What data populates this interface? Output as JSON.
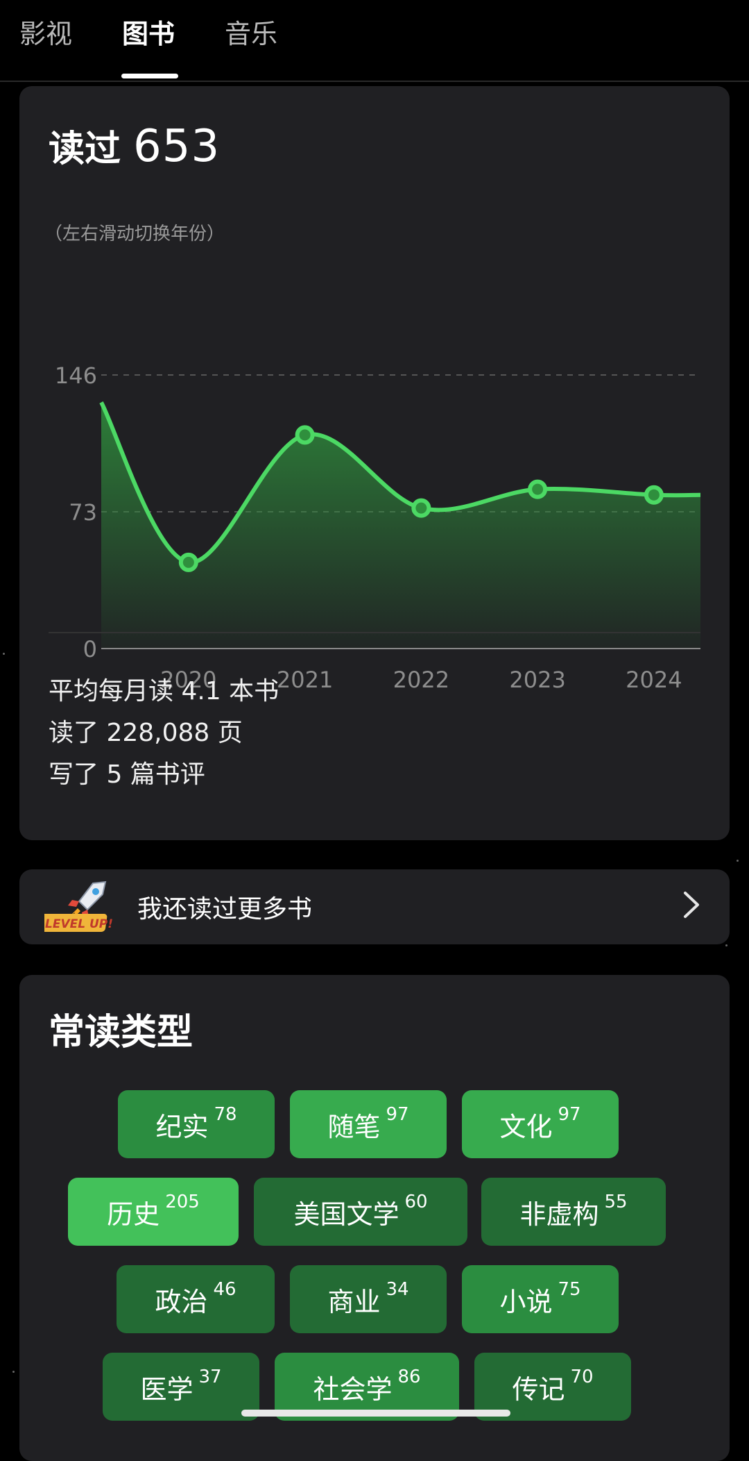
{
  "tabs": [
    {
      "label": "影视"
    },
    {
      "label": "图书"
    },
    {
      "label": "音乐"
    }
  ],
  "active_tab_index": 1,
  "stats": {
    "read_prefix": "读过",
    "read_total": "653",
    "hint": "（左右滑动切换年份）",
    "lines": [
      "平均每月读 4.1 本书",
      "读了 228,088 页",
      "写了 5 篇书评"
    ]
  },
  "chart_data": {
    "type": "area",
    "x": [
      "2020",
      "2021",
      "2022",
      "2023",
      "2024"
    ],
    "series": [
      {
        "values": [
          46,
          114,
          75,
          85,
          82
        ]
      }
    ],
    "yticks": [
      "0",
      "73",
      "146"
    ],
    "ylim": [
      0,
      146
    ],
    "grid": true,
    "line_color": "#4cd964",
    "fill_color": "#2f8f3d"
  },
  "more_books": {
    "label": "我还读过更多书",
    "icon": "rocket-level-up-icon",
    "badge_text": "LEVEL UP!"
  },
  "genres": {
    "title": "常读类型",
    "items": [
      {
        "name": "纪实",
        "count": "78"
      },
      {
        "name": "随笔",
        "count": "97"
      },
      {
        "name": "文化",
        "count": "97"
      },
      {
        "name": "历史",
        "count": "205"
      },
      {
        "name": "美国文学",
        "count": "60"
      },
      {
        "name": "非虚构",
        "count": "55"
      },
      {
        "name": "政治",
        "count": "46"
      },
      {
        "name": "商业",
        "count": "34"
      },
      {
        "name": "小说",
        "count": "75"
      },
      {
        "name": "医学",
        "count": "37"
      },
      {
        "name": "社会学",
        "count": "86"
      },
      {
        "name": "传记",
        "count": "70"
      }
    ]
  }
}
